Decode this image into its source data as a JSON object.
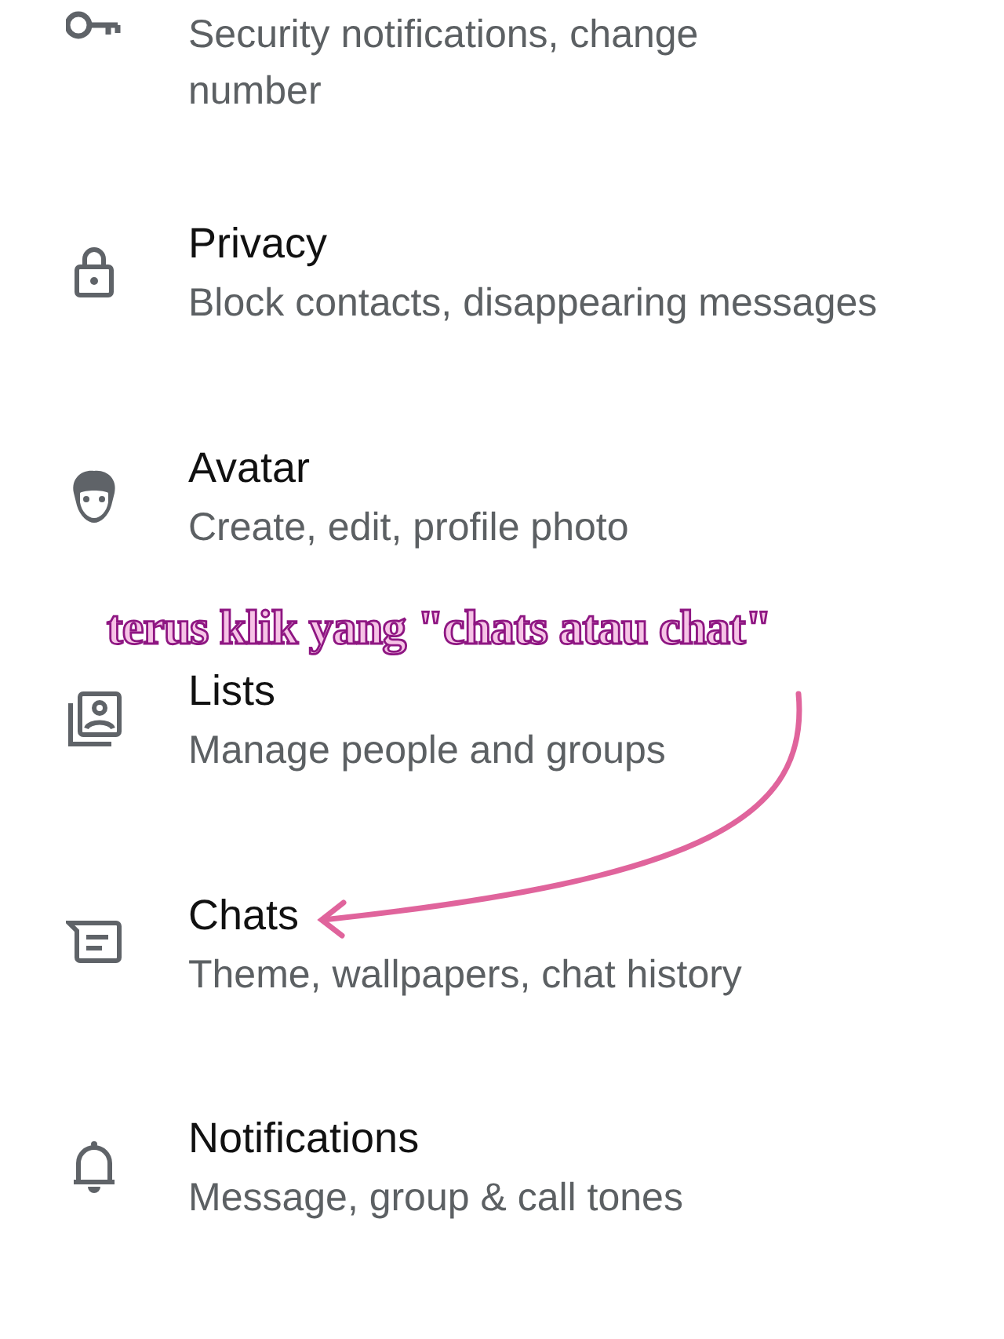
{
  "settings": [
    {
      "kind": "key",
      "subtitle": "Security notifications, change number"
    },
    {
      "kind": "lock",
      "title": "Privacy",
      "subtitle": "Block contacts, disappearing messages"
    },
    {
      "kind": "avatar",
      "title": "Avatar",
      "subtitle": "Create, edit, profile photo"
    },
    {
      "kind": "lists",
      "title": "Lists",
      "subtitle": "Manage people and groups"
    },
    {
      "kind": "chat",
      "title": "Chats",
      "subtitle": "Theme, wallpapers, chat history"
    },
    {
      "kind": "bell",
      "title": "Notifications",
      "subtitle": "Message, group & call tones"
    }
  ],
  "annotation": {
    "text": "terus klik yang \"chats atau chat\"",
    "kind": "arrow"
  }
}
